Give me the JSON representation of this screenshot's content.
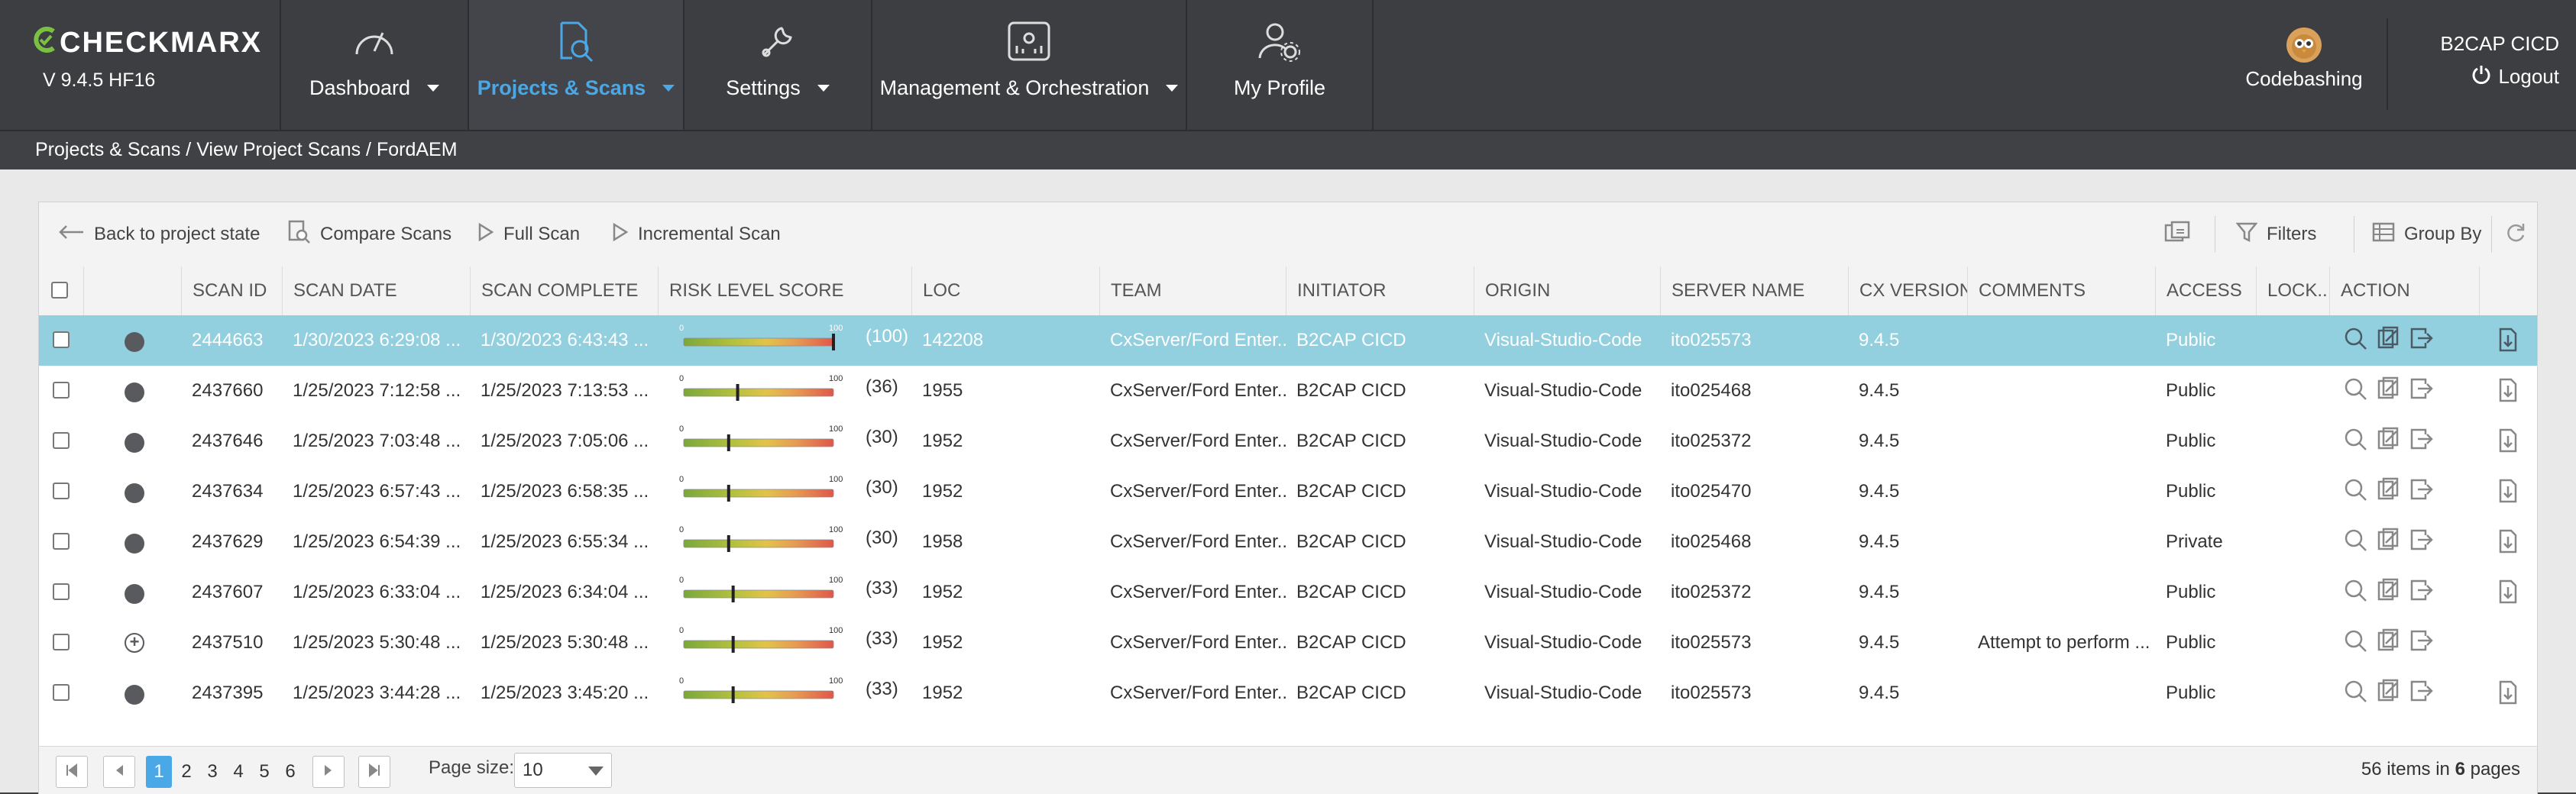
{
  "brand": {
    "logo": "CHECKMARX",
    "version": "V 9.4.5 HF16"
  },
  "nav": [
    {
      "label": "Dashboard",
      "icon": "gauge-icon",
      "dropdown": true
    },
    {
      "label": "Projects & Scans",
      "icon": "search-doc-icon",
      "dropdown": true,
      "active": true
    },
    {
      "label": "Settings",
      "icon": "wrench-icon",
      "dropdown": true
    },
    {
      "label": "Management & Orchestration",
      "icon": "orchestration-icon",
      "dropdown": true
    },
    {
      "label": "My Profile",
      "icon": "user-gear-icon",
      "dropdown": false
    }
  ],
  "codebashing": {
    "label": "Codebashing"
  },
  "user": {
    "name": "B2CAP CICD",
    "logout": "Logout"
  },
  "breadcrumb": "Projects & Scans / View Project Scans / FordAEM",
  "toolbar": {
    "back": "Back to project state",
    "compare": "Compare Scans",
    "full": "Full Scan",
    "incremental": "Incremental Scan",
    "filters": "Filters",
    "groupby": "Group By"
  },
  "columns": [
    "SCAN ID",
    "SCAN DATE",
    "SCAN COMPLETE",
    "RISK LEVEL SCORE",
    "LOC",
    "TEAM",
    "INITIATOR",
    "ORIGIN",
    "SERVER NAME",
    "CX VERSION",
    "COMMENTS",
    "ACCESS",
    "LOCK...",
    "ACTION"
  ],
  "risk_scale": {
    "min": "0",
    "max": "100"
  },
  "rows": [
    {
      "status": "dot",
      "id": "2444663",
      "date": "1/30/2023 6:29:08 ...",
      "complete": "1/30/2023 6:43:43 ...",
      "risk": 100,
      "risk_label": "(100)",
      "loc": "142208",
      "team": "CxServer/Ford Enter...",
      "initiator": "B2CAP CICD",
      "origin": "Visual-Studio-Code",
      "server": "ito025573",
      "version": "9.4.5",
      "comments": "",
      "access": "Public",
      "lock": "",
      "download": true,
      "selected": true
    },
    {
      "status": "dot",
      "id": "2437660",
      "date": "1/25/2023 7:12:58 ...",
      "complete": "1/25/2023 7:13:53 ...",
      "risk": 36,
      "risk_label": "(36)",
      "loc": "1955",
      "team": "CxServer/Ford Enter...",
      "initiator": "B2CAP CICD",
      "origin": "Visual-Studio-Code",
      "server": "ito025468",
      "version": "9.4.5",
      "comments": "",
      "access": "Public",
      "lock": "",
      "download": true
    },
    {
      "status": "dot",
      "id": "2437646",
      "date": "1/25/2023 7:03:48 ...",
      "complete": "1/25/2023 7:05:06 ...",
      "risk": 30,
      "risk_label": "(30)",
      "loc": "1952",
      "team": "CxServer/Ford Enter...",
      "initiator": "B2CAP CICD",
      "origin": "Visual-Studio-Code",
      "server": "ito025372",
      "version": "9.4.5",
      "comments": "",
      "access": "Public",
      "lock": "",
      "download": true
    },
    {
      "status": "dot",
      "id": "2437634",
      "date": "1/25/2023 6:57:43 ...",
      "complete": "1/25/2023 6:58:35 ...",
      "risk": 30,
      "risk_label": "(30)",
      "loc": "1952",
      "team": "CxServer/Ford Enter...",
      "initiator": "B2CAP CICD",
      "origin": "Visual-Studio-Code",
      "server": "ito025470",
      "version": "9.4.5",
      "comments": "",
      "access": "Public",
      "lock": "",
      "download": true
    },
    {
      "status": "dot",
      "id": "2437629",
      "date": "1/25/2023 6:54:39 ...",
      "complete": "1/25/2023 6:55:34 ...",
      "risk": 30,
      "risk_label": "(30)",
      "loc": "1958",
      "team": "CxServer/Ford Enter...",
      "initiator": "B2CAP CICD",
      "origin": "Visual-Studio-Code",
      "server": "ito025468",
      "version": "9.4.5",
      "comments": "",
      "access": "Private",
      "lock": "",
      "download": true
    },
    {
      "status": "dot",
      "id": "2437607",
      "date": "1/25/2023 6:33:04 ...",
      "complete": "1/25/2023 6:34:04 ...",
      "risk": 33,
      "risk_label": "(33)",
      "loc": "1952",
      "team": "CxServer/Ford Enter...",
      "initiator": "B2CAP CICD",
      "origin": "Visual-Studio-Code",
      "server": "ito025372",
      "version": "9.4.5",
      "comments": "",
      "access": "Public",
      "lock": "",
      "download": true
    },
    {
      "status": "plus",
      "id": "2437510",
      "date": "1/25/2023 5:30:48 ...",
      "complete": "1/25/2023 5:30:48 ...",
      "risk": 33,
      "risk_label": "(33)",
      "loc": "1952",
      "team": "CxServer/Ford Enter...",
      "initiator": "B2CAP CICD",
      "origin": "Visual-Studio-Code",
      "server": "ito025573",
      "version": "9.4.5",
      "comments": "Attempt to perform ...",
      "access": "Public",
      "lock": "",
      "download": false
    },
    {
      "status": "dot",
      "id": "2437395",
      "date": "1/25/2023 3:44:28 ...",
      "complete": "1/25/2023 3:45:20 ...",
      "risk": 33,
      "risk_label": "(33)",
      "loc": "1952",
      "team": "CxServer/Ford Enter...",
      "initiator": "B2CAP CICD",
      "origin": "Visual-Studio-Code",
      "server": "ito025573",
      "version": "9.4.5",
      "comments": "",
      "access": "Public",
      "lock": "",
      "download": true
    }
  ],
  "pager": {
    "pages": [
      "1",
      "2",
      "3",
      "4",
      "5",
      "6"
    ],
    "current": "1",
    "page_size_label": "Page size:",
    "page_size": "10",
    "items_count": "56",
    "items_text": "items in",
    "pages_count": "6",
    "pages_text": "pages"
  },
  "colors": {
    "accent": "#4aa8e6",
    "selected_row": "#92cfdf",
    "nav_bg": "#3d3e42",
    "brand_green": "#7ac142"
  }
}
